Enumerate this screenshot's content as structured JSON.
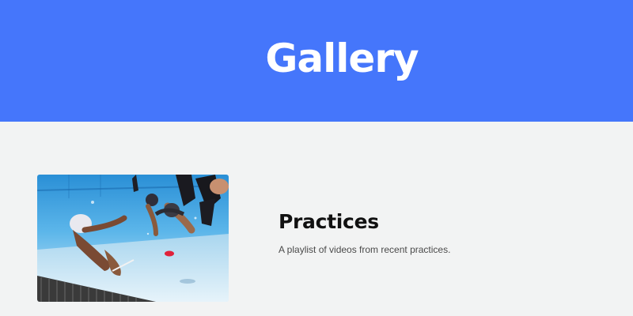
{
  "colors": {
    "header_background": "#4576fb",
    "page_background": "#f2f3f3",
    "title_text": "#ffffff",
    "heading_text": "#111111",
    "body_text": "#4a4a4a"
  },
  "header": {
    "title": "Gallery"
  },
  "gallery": {
    "items": [
      {
        "title": "Practices",
        "description": "A playlist of videos from recent practices."
      }
    ]
  }
}
